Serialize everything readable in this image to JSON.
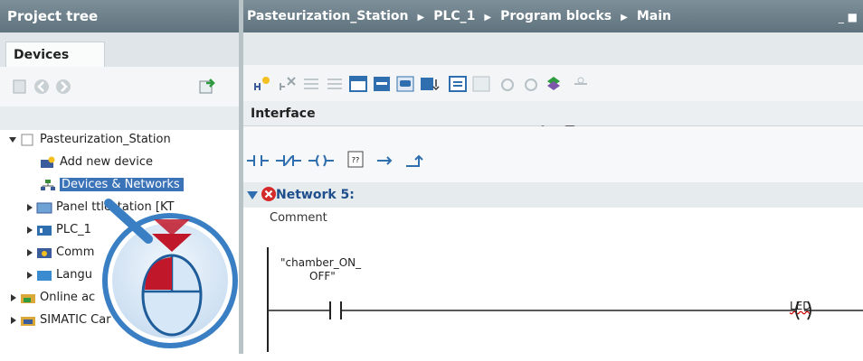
{
  "left_panel": {
    "title": "Project tree",
    "tab": "Devices",
    "tree": {
      "root": "Pasteurization_Station",
      "add_device": "Add new device",
      "devices_networks": "Devices & Networks",
      "panel": "Panel    ttlestation [KT",
      "plc": "PLC_1",
      "common": "Comm",
      "languages": "Langu",
      "online_access": "Online ac",
      "simatic_card": "SIMATIC Car"
    }
  },
  "editor": {
    "breadcrumb": [
      "Pasteurization_Station",
      "PLC_1",
      "Program blocks",
      "Main"
    ],
    "window_buttons": "_ ■",
    "interface_label": "Interface",
    "network_title": "Network 5:",
    "comment": "Comment",
    "contact_label_line1": "\"chamber_ON_",
    "contact_label_line2": "OFF\"",
    "coil_label": "LED",
    "ladder_symbols": [
      "normally-open-contact",
      "normally-closed-contact",
      "output-coil",
      "empty-box",
      "open-branch",
      "close-branch"
    ]
  },
  "colors": {
    "title_bar": "#6b7e89",
    "selection": "#3b73b9",
    "cursor_ring": "#3a7fc4",
    "arrow": "#c0182a"
  }
}
